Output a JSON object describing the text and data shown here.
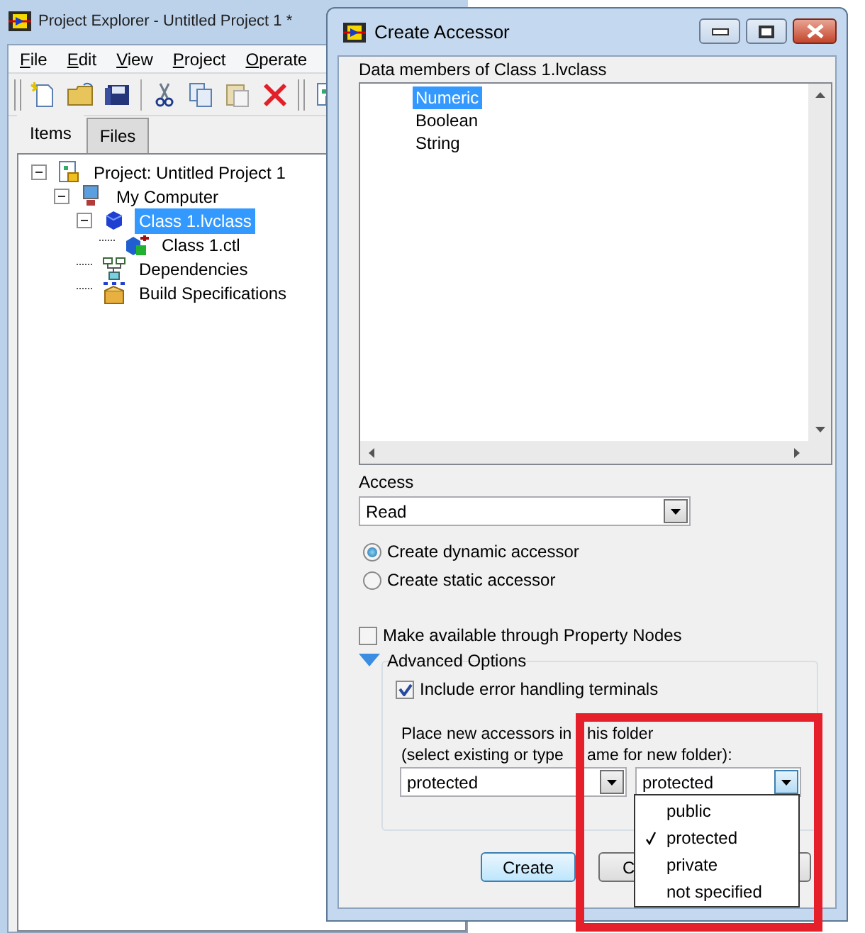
{
  "explorer": {
    "title": "Project Explorer - Untitled Project 1 *",
    "menu": [
      "File",
      "Edit",
      "View",
      "Project",
      "Operate"
    ],
    "tabs": [
      {
        "label": "Items",
        "selected": true
      },
      {
        "label": "Files",
        "selected": false
      }
    ],
    "tree": [
      {
        "label": "Project: Untitled Project 1",
        "kind": "project",
        "selected": false,
        "expanded": true,
        "children": [
          {
            "label": "My Computer",
            "kind": "computer",
            "selected": false,
            "expanded": true,
            "children": [
              {
                "label": "Class 1.lvclass",
                "kind": "class",
                "selected": true,
                "expanded": true,
                "children": [
                  {
                    "label": "Class 1.ctl",
                    "kind": "control",
                    "selected": false
                  }
                ]
              },
              {
                "label": "Dependencies",
                "kind": "dependencies",
                "selected": false
              },
              {
                "label": "Build Specifications",
                "kind": "build",
                "selected": false
              }
            ]
          }
        ]
      }
    ]
  },
  "dialog": {
    "title": "Create Accessor",
    "members_label": "Data members of Class 1.lvclass",
    "members": [
      {
        "label": "Numeric",
        "selected": true
      },
      {
        "label": "Boolean",
        "selected": false
      },
      {
        "label": "String",
        "selected": false
      }
    ],
    "access_label": "Access",
    "access_value": "Read",
    "accessor_types": [
      {
        "label": "Create dynamic accessor",
        "selected": true
      },
      {
        "label": "Create static accessor",
        "selected": false
      }
    ],
    "property_nodes": {
      "label": "Make available through Property Nodes",
      "checked": false
    },
    "advanced": {
      "label": "Advanced Options",
      "expanded": true,
      "error_terminals": {
        "label": "Include error handling terminals",
        "checked": true
      },
      "folder_label": [
        "Place new accessors in",
        "his folder"
      ],
      "folder_hint": [
        "(select existing or type",
        "ame for new folder):"
      ],
      "folder_value": "protected",
      "folder_value_2": "protected",
      "folder_options": [
        {
          "label": "public",
          "selected": false
        },
        {
          "label": "protected",
          "selected": true
        },
        {
          "label": "private",
          "selected": false
        },
        {
          "label": "not specified",
          "selected": false
        }
      ]
    },
    "buttons": [
      "Create",
      "C"
    ]
  }
}
